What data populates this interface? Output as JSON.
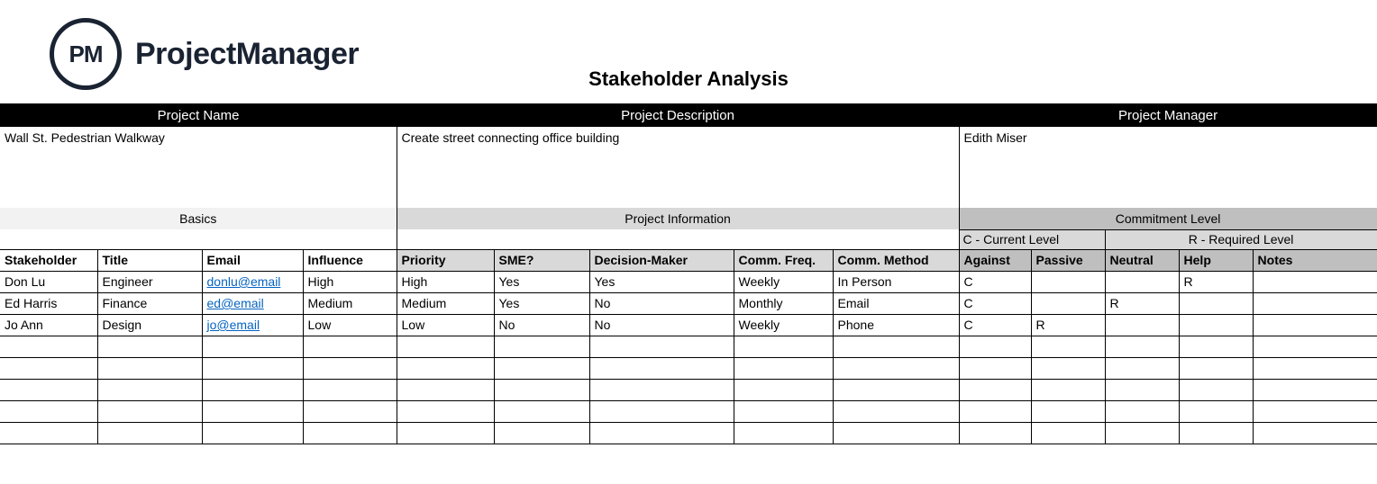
{
  "brand": {
    "logo_abbr": "PM",
    "logo_text": "ProjectManager"
  },
  "title": "Stakeholder Analysis",
  "project_headers": {
    "name": "Project Name",
    "description": "Project Description",
    "manager": "Project Manager"
  },
  "project": {
    "name": "Wall St. Pedestrian Walkway",
    "description": "Create street connecting office building",
    "manager": "Edith Miser"
  },
  "section_headers": {
    "basics": "Basics",
    "project_info": "Project Information",
    "commitment": "Commitment Level"
  },
  "legend": {
    "current": "C - Current Level",
    "required": "R - Required Level"
  },
  "columns": {
    "stakeholder": "Stakeholder",
    "title": "Title",
    "email": "Email",
    "influence": "Influence",
    "priority": "Priority",
    "sme": "SME?",
    "decision": "Decision-Maker",
    "freq": "Comm. Freq.",
    "method": "Comm. Method",
    "against": "Against",
    "passive": "Passive",
    "neutral": "Neutral",
    "help": "Help",
    "notes": "Notes"
  },
  "rows": [
    {
      "stakeholder": "Don Lu",
      "title": "Engineer",
      "email": "donlu@email",
      "influence": "High",
      "priority": "High",
      "sme": "Yes",
      "decision": "Yes",
      "freq": "Weekly",
      "method": "In Person",
      "against": "C",
      "passive": "",
      "neutral": "",
      "help": "R",
      "notes": ""
    },
    {
      "stakeholder": "Ed Harris",
      "title": "Finance",
      "email": "ed@email",
      "influence": "Medium",
      "priority": "Medium",
      "sme": "Yes",
      "decision": "No",
      "freq": "Monthly",
      "method": "Email",
      "against": "C",
      "passive": "",
      "neutral": "R",
      "help": "",
      "notes": ""
    },
    {
      "stakeholder": "Jo Ann",
      "title": "Design",
      "email": "jo@email",
      "influence": "Low",
      "priority": "Low",
      "sme": "No",
      "decision": "No",
      "freq": "Weekly",
      "method": "Phone",
      "against": "C",
      "passive": "R",
      "neutral": "",
      "help": "",
      "notes": ""
    },
    {
      "stakeholder": "",
      "title": "",
      "email": "",
      "influence": "",
      "priority": "",
      "sme": "",
      "decision": "",
      "freq": "",
      "method": "",
      "against": "",
      "passive": "",
      "neutral": "",
      "help": "",
      "notes": ""
    },
    {
      "stakeholder": "",
      "title": "",
      "email": "",
      "influence": "",
      "priority": "",
      "sme": "",
      "decision": "",
      "freq": "",
      "method": "",
      "against": "",
      "passive": "",
      "neutral": "",
      "help": "",
      "notes": ""
    },
    {
      "stakeholder": "",
      "title": "",
      "email": "",
      "influence": "",
      "priority": "",
      "sme": "",
      "decision": "",
      "freq": "",
      "method": "",
      "against": "",
      "passive": "",
      "neutral": "",
      "help": "",
      "notes": ""
    },
    {
      "stakeholder": "",
      "title": "",
      "email": "",
      "influence": "",
      "priority": "",
      "sme": "",
      "decision": "",
      "freq": "",
      "method": "",
      "against": "",
      "passive": "",
      "neutral": "",
      "help": "",
      "notes": ""
    },
    {
      "stakeholder": "",
      "title": "",
      "email": "",
      "influence": "",
      "priority": "",
      "sme": "",
      "decision": "",
      "freq": "",
      "method": "",
      "against": "",
      "passive": "",
      "neutral": "",
      "help": "",
      "notes": ""
    }
  ]
}
